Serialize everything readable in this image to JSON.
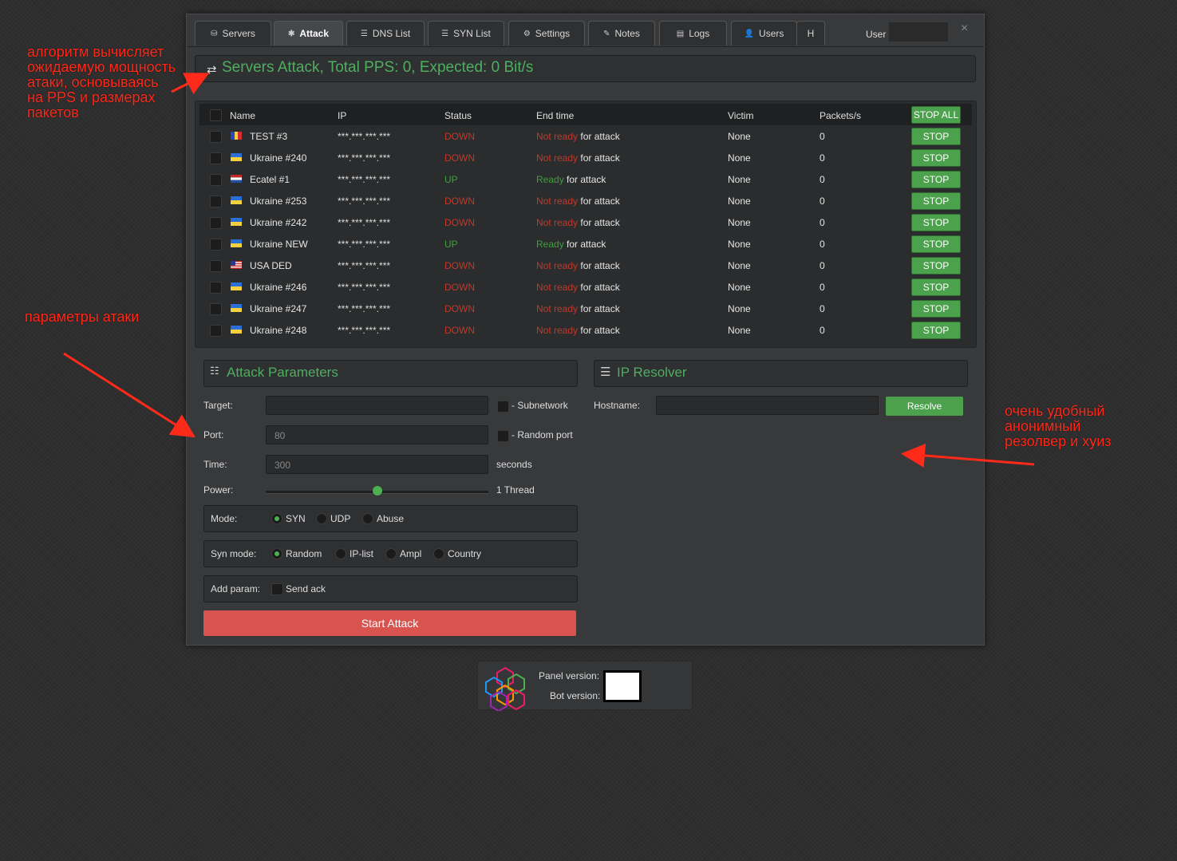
{
  "tabs": [
    {
      "label": "Servers",
      "icon": "server-icon",
      "glyph": "⛁"
    },
    {
      "label": "Attack",
      "icon": "attack-icon",
      "glyph": "✱"
    },
    {
      "label": "DNS List",
      "icon": "list-icon",
      "glyph": "☰"
    },
    {
      "label": "SYN List",
      "icon": "list-icon",
      "glyph": "☰"
    },
    {
      "label": "Settings",
      "icon": "gears-icon",
      "glyph": "⚙"
    },
    {
      "label": "Notes",
      "icon": "edit-icon",
      "glyph": "✎"
    },
    {
      "label": "Logs",
      "icon": "file-icon",
      "glyph": "▤"
    },
    {
      "label": "Users",
      "icon": "user-icon",
      "glyph": "👤"
    },
    {
      "label": "H",
      "icon": "",
      "glyph": ""
    }
  ],
  "header": {
    "user_label": "User",
    "close_glyph": "×"
  },
  "attack_panel": {
    "title": "Servers Attack, Total PPS: 0, Expected: 0 Bit/s"
  },
  "table": {
    "columns": [
      "Name",
      "IP",
      "Status",
      "End time",
      "Victim",
      "Packets/s"
    ],
    "stop_all_label": "STOP ALL",
    "stop_label": "STOP",
    "rows": [
      {
        "name": "TEST #3",
        "flag": "RO",
        "ip": "***.***.***.***",
        "status": "DOWN",
        "end_state": "Not ready",
        "end_suffix": " for attack",
        "victim": "None",
        "pps": "0"
      },
      {
        "name": "Ukraine #240",
        "flag": "UA",
        "ip": "***.***.***.***",
        "status": "DOWN",
        "end_state": "Not ready",
        "end_suffix": " for attack",
        "victim": "None",
        "pps": "0"
      },
      {
        "name": "Ecatel #1",
        "flag": "NL",
        "ip": "***.***.***.***",
        "status": "UP",
        "end_state": "Ready",
        "end_suffix": " for attack",
        "victim": "None",
        "pps": "0"
      },
      {
        "name": "Ukraine #253",
        "flag": "UA",
        "ip": "***.***.***.***",
        "status": "DOWN",
        "end_state": "Not ready",
        "end_suffix": " for attack",
        "victim": "None",
        "pps": "0"
      },
      {
        "name": "Ukraine #242",
        "flag": "UA",
        "ip": "***.***.***.***",
        "status": "DOWN",
        "end_state": "Not ready",
        "end_suffix": " for attack",
        "victim": "None",
        "pps": "0"
      },
      {
        "name": "Ukraine NEW",
        "flag": "UA",
        "ip": "***.***.***.***",
        "status": "UP",
        "end_state": "Ready",
        "end_suffix": " for attack",
        "victim": "None",
        "pps": "0"
      },
      {
        "name": "USA DED",
        "flag": "US",
        "ip": "***.***.***.***",
        "status": "DOWN",
        "end_state": "Not ready",
        "end_suffix": " for attack",
        "victim": "None",
        "pps": "0"
      },
      {
        "name": "Ukraine #246",
        "flag": "UA",
        "ip": "***.***.***.***",
        "status": "DOWN",
        "end_state": "Not ready",
        "end_suffix": " for attack",
        "victim": "None",
        "pps": "0"
      },
      {
        "name": "Ukraine #247",
        "flag": "UA",
        "ip": "***.***.***.***",
        "status": "DOWN",
        "end_state": "Not ready",
        "end_suffix": " for attack",
        "victim": "None",
        "pps": "0"
      },
      {
        "name": "Ukraine #248",
        "flag": "UA",
        "ip": "***.***.***.***",
        "status": "DOWN",
        "end_state": "Not ready",
        "end_suffix": " for attack",
        "victim": "None",
        "pps": "0"
      }
    ]
  },
  "params": {
    "title": "Attack Parameters",
    "target_label": "Target:",
    "target_value": "",
    "subnetwork_label": "- Subnetwork",
    "port_label": "Port:",
    "port_value": "80",
    "random_port_label": "- Random port",
    "time_label": "Time:",
    "time_value": "300",
    "time_unit": "seconds",
    "power_label": "Power:",
    "power_value": "1 Thread",
    "power_level": 0.5,
    "mode_label": "Mode:",
    "modes": [
      "SYN",
      "UDP",
      "Abuse"
    ],
    "mode_selected": "SYN",
    "syn_mode_label": "Syn mode:",
    "syn_modes": [
      "Random",
      "IP-list",
      "Ampl",
      "Country"
    ],
    "syn_mode_selected": "Random",
    "add_param_label": "Add param:",
    "send_ack_label": "Send ack",
    "start_label": "Start Attack"
  },
  "resolver": {
    "title": "IP Resolver",
    "hostname_label": "Hostname:",
    "hostname_value": "",
    "resolve_label": "Resolve"
  },
  "footer": {
    "panel_version_label": "Panel version:",
    "bot_version_label": "Bot version:"
  },
  "annotations": {
    "top_left": "алгоритм вычисляет\nожидаемую мощность\nатаки, основываясь\nна PPS и размерах\nпакетов",
    "params": "параметры атаки",
    "resolver": "очень удобный\nанонимный\nрезолвер и хуиз"
  },
  "colors": {
    "accent_green": "#4fae60",
    "stop_green": "#4ca14c",
    "danger_red": "#d9534f",
    "annotation_red": "#ff2a1a"
  }
}
